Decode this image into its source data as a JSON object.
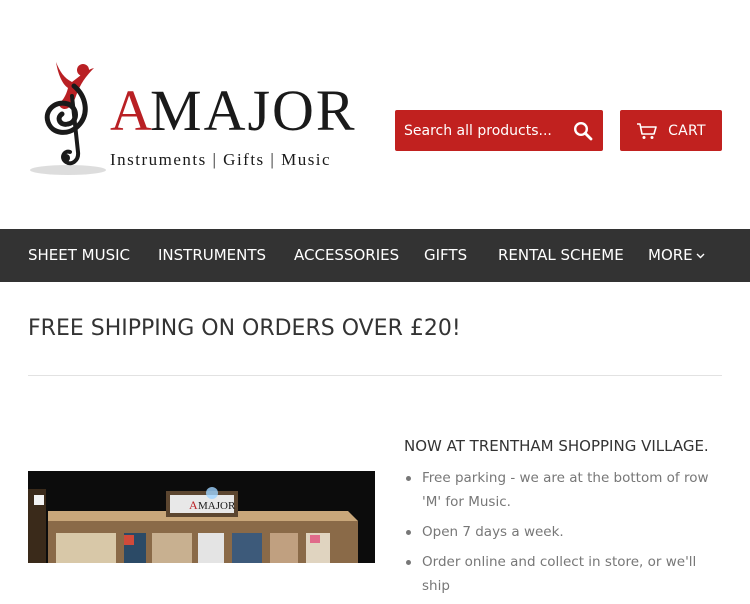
{
  "logo": {
    "brand_a": "A",
    "brand_rest": "MAJOR",
    "tagline": "Instruments | Gifts | Music",
    "brand_color": "#b92024"
  },
  "search": {
    "placeholder": "Search all products...",
    "icon": "search-icon"
  },
  "cart": {
    "label": "CART",
    "icon": "cart-icon"
  },
  "nav": {
    "items": [
      {
        "label": "SHEET MUSIC"
      },
      {
        "label": "INSTRUMENTS"
      },
      {
        "label": "ACCESSORIES"
      },
      {
        "label": "GIFTS"
      },
      {
        "label": "RENTAL SCHEME"
      },
      {
        "label": "MORE"
      }
    ],
    "more_icon": "chevron-down-icon"
  },
  "announcement": "FREE SHIPPING ON ORDERS OVER £20!",
  "store_photo": {
    "sign_a": "A",
    "sign_text": "MAJOR"
  },
  "store_info": {
    "title": "NOW AT TRENTHAM SHOPPING VILLAGE.",
    "items": [
      "Free parking - we are at the bottom of row 'M' for Music.",
      "Open 7 days a week.",
      "Order online and collect in store, or we'll ship"
    ]
  },
  "colors": {
    "accent": "#c1211f",
    "nav_background": "#333333",
    "text": "#333333",
    "muted_text": "#777777"
  }
}
